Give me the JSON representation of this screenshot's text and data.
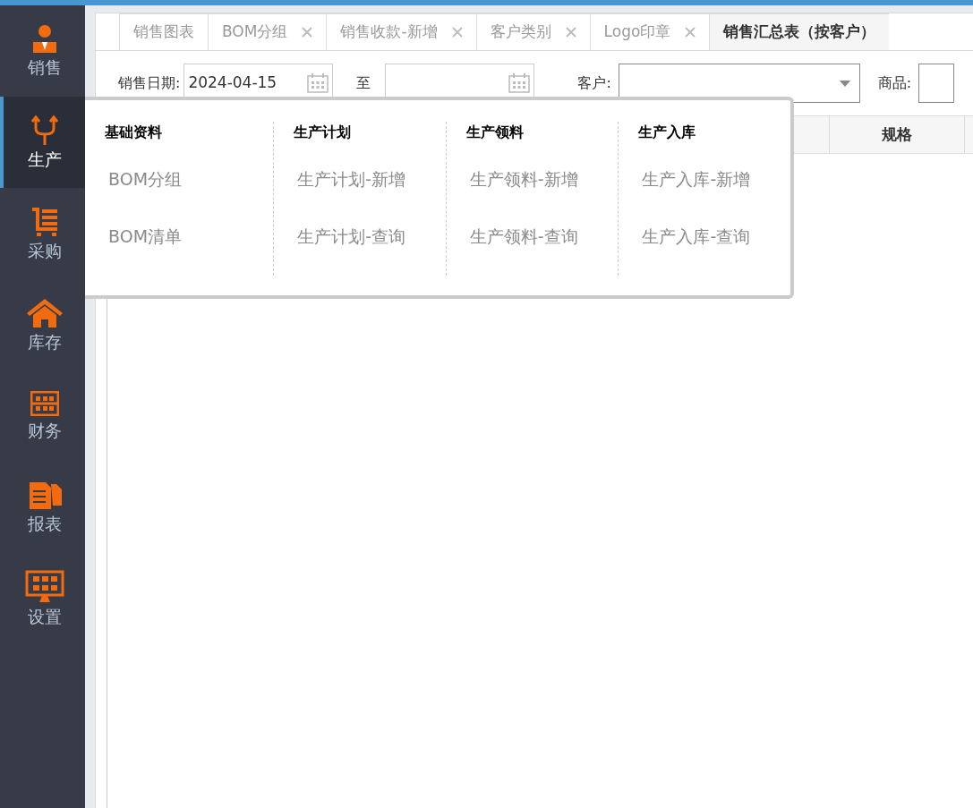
{
  "sidebar": {
    "items": [
      {
        "label": "销售",
        "kind": "person",
        "selected": false
      },
      {
        "label": "生产",
        "kind": "fork",
        "selected": true
      },
      {
        "label": "采购",
        "kind": "cart",
        "selected": false
      },
      {
        "label": "库存",
        "kind": "house",
        "selected": false
      },
      {
        "label": "财务",
        "kind": "abacus",
        "selected": false
      },
      {
        "label": "报表",
        "kind": "docs",
        "selected": false
      },
      {
        "label": "设置",
        "kind": "monitor",
        "selected": false
      }
    ]
  },
  "tabs": [
    {
      "label": "销售图表",
      "closable": false,
      "selected": false
    },
    {
      "label": "BOM分组",
      "closable": true,
      "selected": false
    },
    {
      "label": "销售收款-新增",
      "closable": true,
      "selected": false
    },
    {
      "label": "客户类别",
      "closable": true,
      "selected": false
    },
    {
      "label": "Logo印章",
      "closable": true,
      "selected": false
    },
    {
      "label": "销售汇总表（按客户）",
      "closable": false,
      "selected": true
    }
  ],
  "filters": {
    "date_label": "销售日期:",
    "date_from": "2024-04-15",
    "to_label": "至",
    "customer_label": "客户:",
    "product_label": "商品:"
  },
  "table": {
    "columns": [
      "规格"
    ]
  },
  "menu": {
    "groups": [
      {
        "title": "基础资料",
        "items": [
          "BOM分组",
          "BOM清单"
        ]
      },
      {
        "title": "生产计划",
        "items": [
          "生产计划-新增",
          "生产计划-查询"
        ]
      },
      {
        "title": "生产领料",
        "items": [
          "生产领料-新增",
          "生产领料-查询"
        ]
      },
      {
        "title": "生产入库",
        "items": [
          "生产入库-新增",
          "生产入库-查询"
        ]
      }
    ]
  }
}
